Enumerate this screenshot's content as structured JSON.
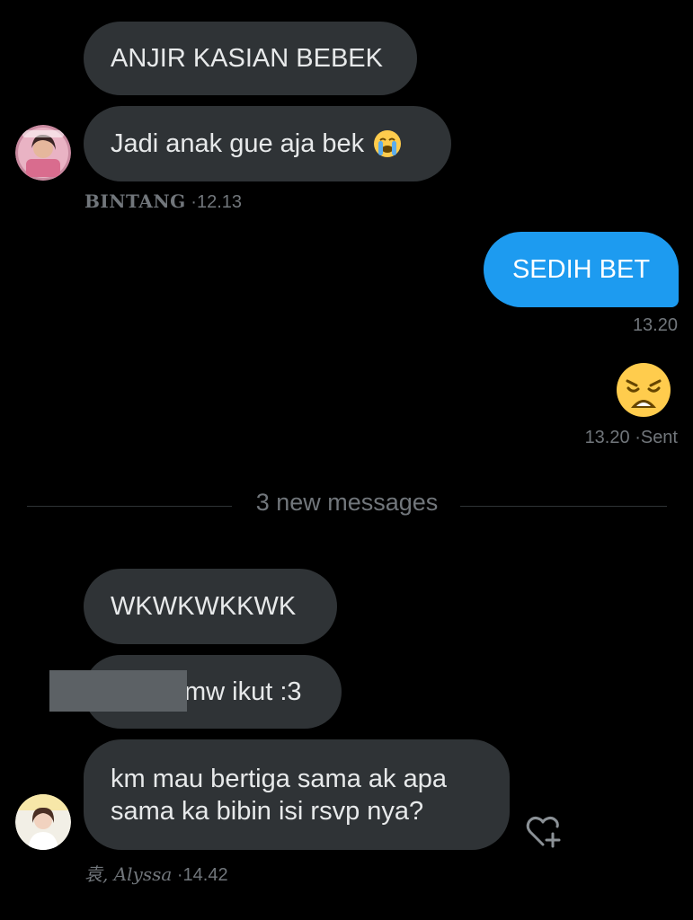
{
  "messages": [
    {
      "text": "ANJIR KASIAN BEBEK"
    },
    {
      "text": "Jadi anak gue aja bek",
      "emoji": "😭"
    },
    {
      "text": "SEDIH BET"
    },
    {
      "text": "😩"
    },
    {
      "text": "WKWKWKKWK"
    },
    {
      "text": "mw ikut :3"
    },
    {
      "line1": "km mau bertiga sama ak apa",
      "line2": "sama ka bibin isi rsvp nya?"
    }
  ],
  "meta": {
    "bintang_name": "BINTANG",
    "bintang_time": "·12.13",
    "out1_time": "13.20",
    "out2_time": "13.20",
    "out2_status": "·Sent",
    "alyssa_name": "袁, Alyssa",
    "alyssa_time": "·14.42"
  },
  "divider": "3 new messages",
  "colors": {
    "background": "#000000",
    "incoming_bubble": "#2f3336",
    "outgoing_bubble": "#1d9bf0",
    "muted_text": "#71767b"
  },
  "icons": {
    "react": "heart-plus-icon"
  }
}
